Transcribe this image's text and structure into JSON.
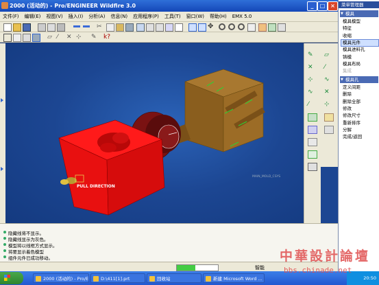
{
  "window": {
    "title": "2000 (活动的) - Pro/ENGINEER Wildfire 3.0",
    "buttons": [
      "_",
      "□",
      "×"
    ]
  },
  "menubar": [
    "文件(F)",
    "编辑(E)",
    "视图(V)",
    "插入(I)",
    "分析(A)",
    "信息(N)",
    "应用程序(P)",
    "工具(T)",
    "窗口(W)",
    "帮助(H)",
    "EMX 5.0"
  ],
  "viewport": {
    "pull_direction_label": "PULL DIRECTION",
    "csys_label": "MAIN_MOLD_CSYS"
  },
  "messages": [
    "隐藏线将不显示。",
    "隐藏线显示为灰色。",
    "模型将以线框方式显示。",
    "将要显示着色模型",
    "组件元件已成功移动。"
  ],
  "status": {
    "progress": 0.45,
    "mode": "智能"
  },
  "menu_manager": {
    "title": "菜单管理器",
    "sections": [
      {
        "label": "模具",
        "items": [
          {
            "label": "模具模型",
            "selected": false,
            "disabled": false
          },
          {
            "label": "特征",
            "selected": false,
            "disabled": false
          },
          {
            "label": "收缩",
            "selected": false,
            "disabled": false
          },
          {
            "label": "模具元件",
            "selected": true,
            "disabled": false
          },
          {
            "label": "模具进料孔",
            "selected": false,
            "disabled": false
          },
          {
            "label": "铸模",
            "selected": false,
            "disabled": false
          },
          {
            "label": "模具布局",
            "selected": false,
            "disabled": false
          },
          {
            "label": "集成",
            "selected": false,
            "disabled": true
          }
        ]
      },
      {
        "label": "模具孔",
        "items": [
          {
            "label": "定义间距",
            "selected": false,
            "disabled": false
          },
          {
            "label": "删除",
            "selected": false,
            "disabled": false
          },
          {
            "label": "删除全部",
            "selected": false,
            "disabled": false
          },
          {
            "label": "修改",
            "selected": false,
            "disabled": false
          },
          {
            "label": "修改尺寸",
            "selected": false,
            "disabled": false
          },
          {
            "label": "重新排序",
            "selected": false,
            "disabled": false
          },
          {
            "label": "分解",
            "selected": false,
            "disabled": false
          },
          {
            "label": "完成/返回",
            "selected": false,
            "disabled": false
          }
        ]
      }
    ]
  },
  "taskbar": {
    "tasks": [
      "2000 (活动的) - Pro/E...",
      "D:\\411[1].prt",
      "回收站",
      "新建 Microsoft Word ..."
    ],
    "clock": "20:50"
  },
  "watermark": {
    "text": "中華設計論壇",
    "url": "bbs.chinade.net"
  },
  "colors": {
    "cavity_block": "#e81212",
    "core_block": "#9a6a28",
    "viewport_bg": "#1c4692"
  }
}
